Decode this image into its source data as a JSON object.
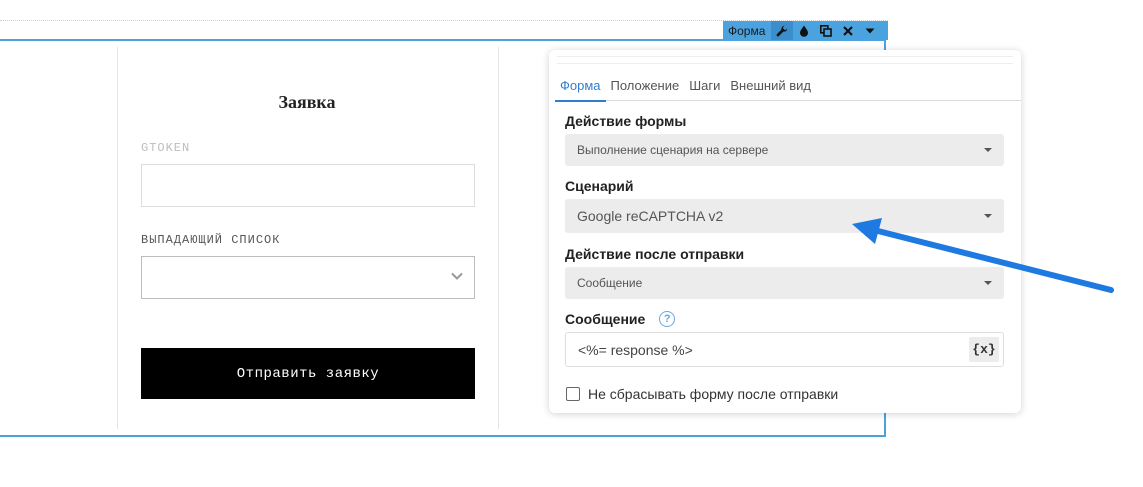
{
  "toolbar": {
    "label": "Форма",
    "icons": [
      "wrench-icon",
      "drop-icon",
      "copy-icon",
      "close-icon",
      "caret-down-icon"
    ]
  },
  "form": {
    "title": "Заявка",
    "gtoken_label": "GTOKEN",
    "gtoken_value": "",
    "dropdown_label": "ВЫПАДАЮЩИЙ СПИСОК",
    "dropdown_value": "",
    "submit_label": "Отправить заявку"
  },
  "panel": {
    "tabs": [
      {
        "label": "Форма",
        "active": true
      },
      {
        "label": "Положение",
        "active": false
      },
      {
        "label": "Шаги",
        "active": false
      },
      {
        "label": "Внешний вид",
        "active": false
      }
    ],
    "form_action_label": "Действие формы",
    "form_action_value": "Выполнение сценария на сервере",
    "scenario_label": "Сценарий",
    "scenario_value": "Google reCAPTCHA v2",
    "after_submit_label": "Действие после отправки",
    "after_submit_value": "Сообщение",
    "message_label": "Сообщение",
    "help_glyph": "?",
    "message_value": "<%= response %>",
    "var_button": "{x}",
    "reset_checkbox_label": "Не сбрасывать форму после отправки",
    "reset_checkbox_checked": false
  },
  "colors": {
    "selection": "#4aa3df",
    "active_tab": "#2f7fcf",
    "arrow": "#1e7ae0",
    "submit_bg": "#000000"
  }
}
